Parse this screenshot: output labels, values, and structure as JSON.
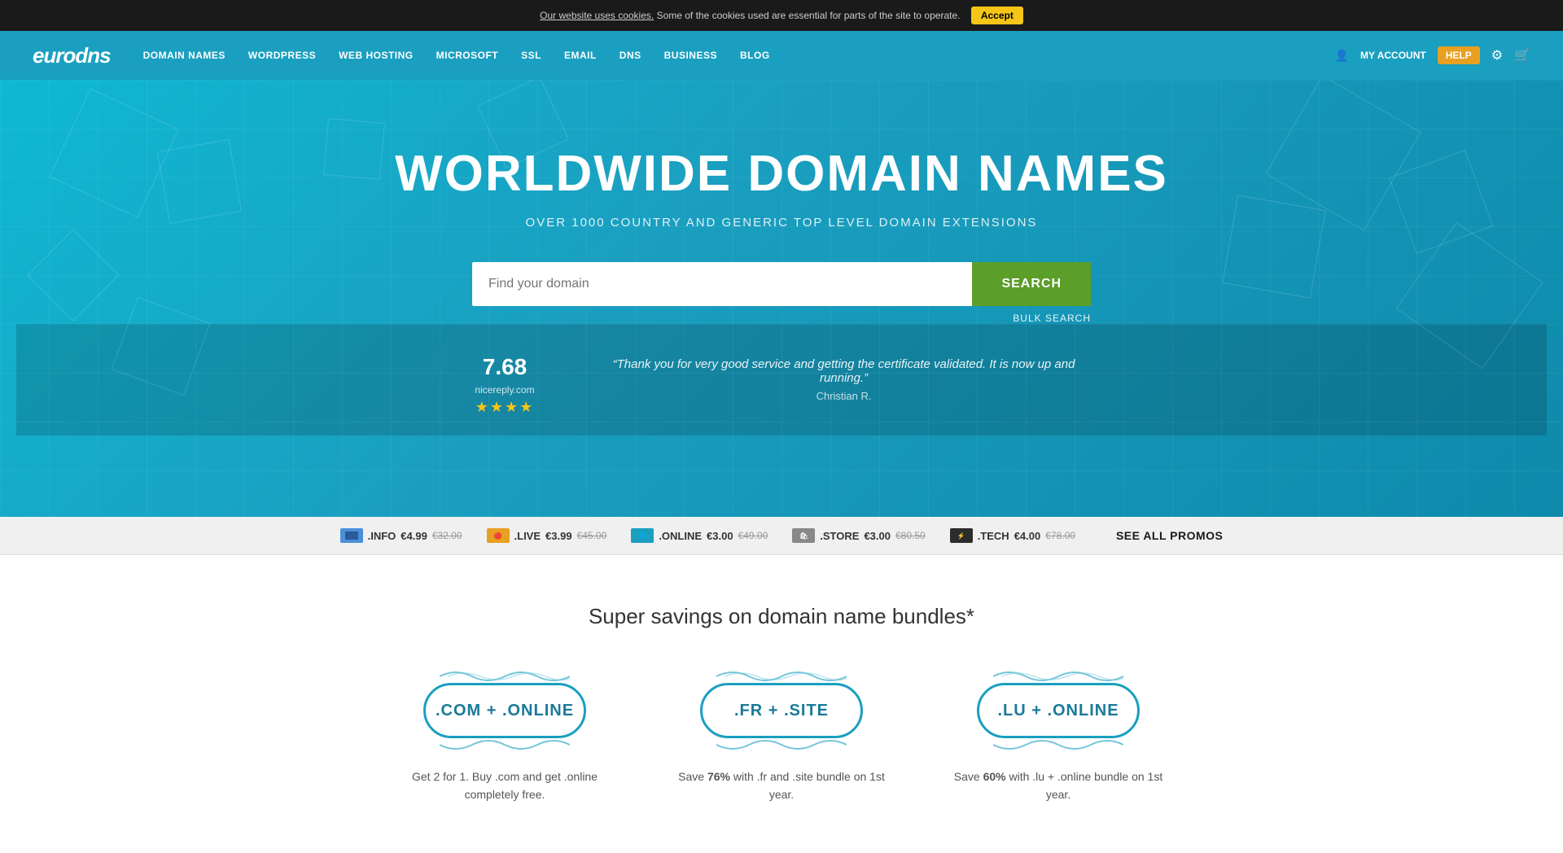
{
  "cookie_banner": {
    "text_before_link": "Our website uses cookies.",
    "link_text": "Our website uses cookies.",
    "text_after": " Some of the cookies used are essential for parts of the site to operate.",
    "accept_label": "Accept"
  },
  "navbar": {
    "logo": "euroDNS",
    "links": [
      {
        "label": "DOMAIN NAMES",
        "id": "domain-names"
      },
      {
        "label": "WORDPRESS",
        "id": "wordpress"
      },
      {
        "label": "WEB HOSTING",
        "id": "web-hosting"
      },
      {
        "label": "MICROSOFT",
        "id": "microsoft"
      },
      {
        "label": "SSL",
        "id": "ssl"
      },
      {
        "label": "EMAIL",
        "id": "email"
      },
      {
        "label": "DNS",
        "id": "dns"
      },
      {
        "label": "BUSINESS",
        "id": "business"
      },
      {
        "label": "BLOG",
        "id": "blog"
      }
    ],
    "my_account": "MY ACCOUNT",
    "help": "HELP"
  },
  "hero": {
    "title": "WORLDWIDE DOMAIN NAMES",
    "subtitle": "OVER 1000 COUNTRY AND GENERIC TOP LEVEL DOMAIN EXTENSIONS",
    "search_placeholder": "Find your domain",
    "search_button": "SEARCH",
    "bulk_search": "BULK SEARCH"
  },
  "rating": {
    "score": "7",
    "decimal": ".68",
    "source": "nicereply.com",
    "stars": "★★★★",
    "testimonial": "“Thank you for very good service and getting the certificate validated. It is now up and running.”",
    "author": "Christian R."
  },
  "promo_bar": {
    "items": [
      {
        "icon": "info-icon",
        "tld": ".INFO",
        "price": "€4.99",
        "old_price": "€32.00"
      },
      {
        "icon": "live-icon",
        "tld": ".LIVE",
        "price": "€3.99",
        "old_price": "€45.00"
      },
      {
        "icon": "online-icon",
        "tld": ".ONLINE",
        "price": "€3.00",
        "old_price": "€49.00"
      },
      {
        "icon": "store-icon",
        "tld": ".STORE",
        "price": "€3.00",
        "old_price": "€80.50"
      },
      {
        "icon": "tech-icon",
        "tld": ".TECH",
        "price": "€4.00",
        "old_price": "€78.00"
      }
    ],
    "see_all": "SEE ALL PROMOS"
  },
  "bundles_section": {
    "title": "Super savings on domain name bundles*",
    "bundles": [
      {
        "badge_text": ".COM + .ONLINE",
        "description": "Get 2 for 1. Buy .com and get .online completely free."
      },
      {
        "badge_text": ".FR + .SITE",
        "description": "Save 76% with .fr and .site bundle on 1st year."
      },
      {
        "badge_text": ".LU + .ONLINE",
        "description": "Save 60% with .lu + .online bundle on 1st year."
      }
    ]
  }
}
